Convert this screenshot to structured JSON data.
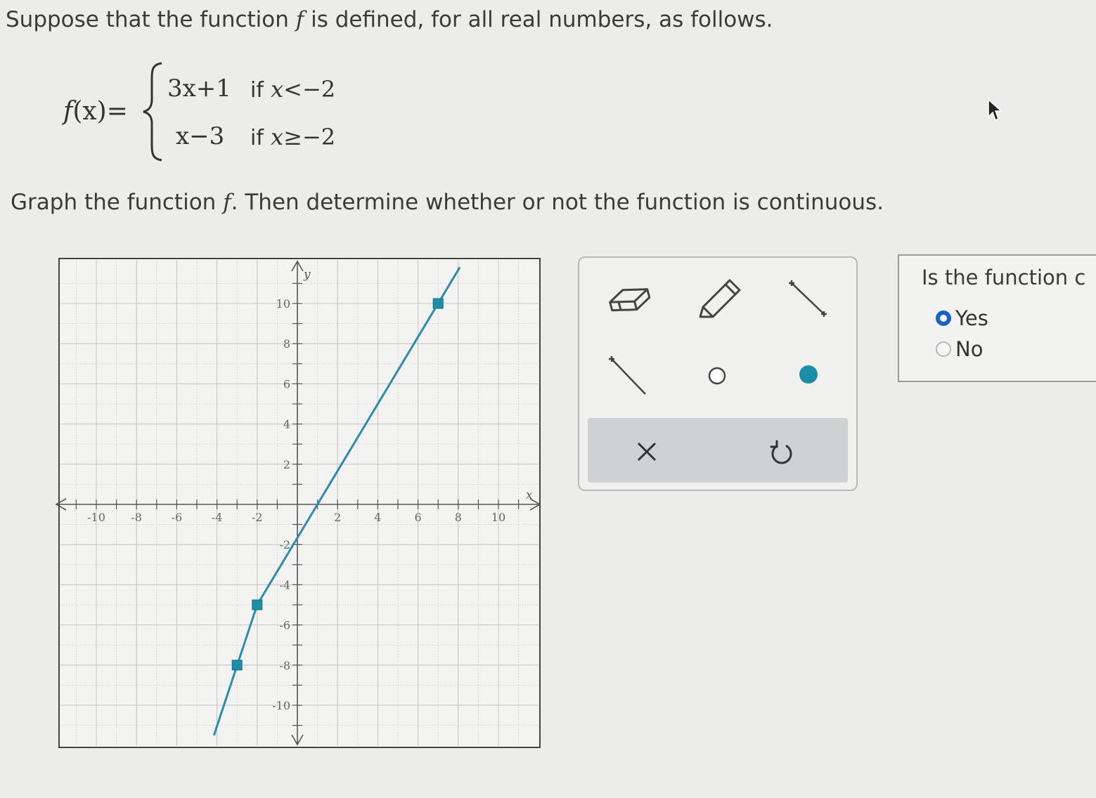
{
  "prompt": {
    "line1_before": "Suppose that the function ",
    "line1_var": "f",
    "line1_after": " is defined, for all real numbers, as follows.",
    "line2_before": "Graph the function ",
    "line2_var": "f",
    "line2_after": ". Then determine whether or not the function is continuous."
  },
  "function": {
    "lhs_f": "f",
    "lhs_x": "(x)",
    "lhs_eq": "=",
    "pieces": [
      {
        "expr": "3x+1",
        "cond_kw": "if",
        "cond_var": "x",
        "cond_rel": "<−2"
      },
      {
        "expr": "x−3",
        "cond_kw": "if",
        "cond_var": "x",
        "cond_rel": "≥−2"
      }
    ]
  },
  "graph": {
    "x_axis_label": "x",
    "y_axis_label": "y",
    "x_range": [
      -10,
      10
    ],
    "y_range": [
      -10,
      10
    ],
    "minor_step": 1,
    "x_tick_labels": [
      -10,
      -8,
      -6,
      -4,
      -2,
      2,
      4,
      6,
      8,
      10
    ],
    "y_tick_labels": [
      -10,
      -8,
      -6,
      -4,
      -2,
      2,
      4,
      6,
      8,
      10
    ],
    "line_color": "#2e8bad",
    "point_color": "#1b8fa8",
    "segments": [
      {
        "name": "segment-left",
        "points": [
          [
            -4,
            -11
          ],
          [
            -2,
            -5
          ]
        ]
      },
      {
        "name": "segment-right",
        "points": [
          [
            -2,
            -5
          ],
          [
            7,
            10
          ]
        ]
      }
    ],
    "plotted_points": [
      [
        -3,
        -8
      ],
      [
        -2,
        -5
      ],
      [
        7,
        10
      ]
    ],
    "note_right_segment_extends_to_top": true
  },
  "tools": {
    "eraser": "eraser-icon",
    "pencil": "pencil-icon",
    "segment": "line-segment-icon",
    "ray": "ray-icon",
    "open_point": "open-circle-icon",
    "closed_point": "closed-circle-icon",
    "clear": "×",
    "undo": "undo-icon",
    "accent": "#1b8fa8"
  },
  "question": {
    "text": "Is the function c",
    "options": [
      {
        "label": "Yes",
        "selected": true
      },
      {
        "label": "No",
        "selected": false
      }
    ]
  }
}
